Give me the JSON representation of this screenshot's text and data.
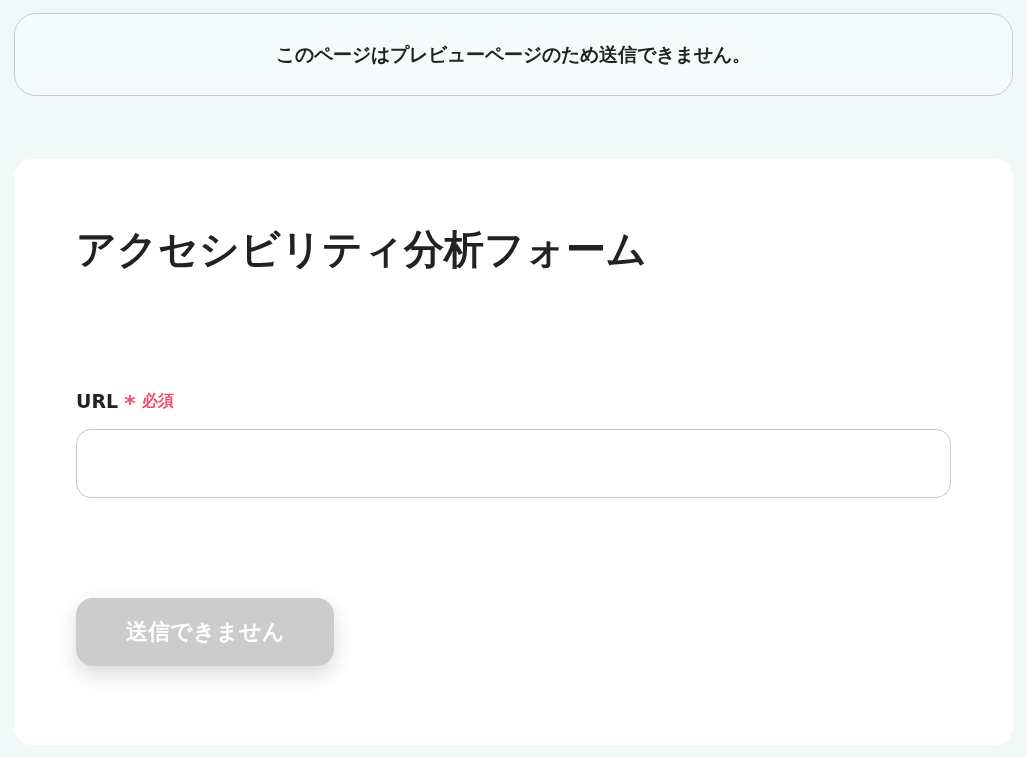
{
  "notice": {
    "text": "このページはプレビューページのため送信できません。"
  },
  "form": {
    "title": "アクセシビリティ分析フォーム",
    "fields": [
      {
        "label": "URL",
        "required": true,
        "required_mark": "*",
        "required_text": "必須"
      }
    ],
    "submit": {
      "label": "送信できません",
      "disabled": true
    }
  }
}
